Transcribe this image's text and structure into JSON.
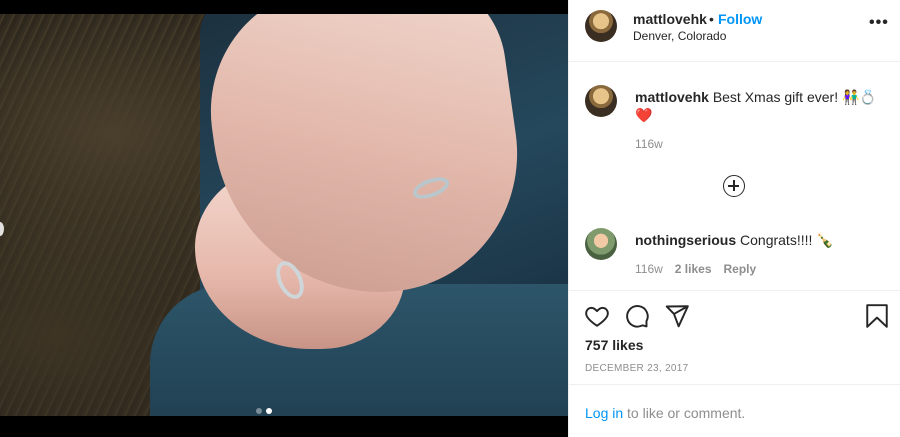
{
  "photo": {
    "carousel_total": 2,
    "carousel_active_index": 2
  },
  "header": {
    "username": "mattlovehk",
    "separator": "•",
    "follow_label": "Follow",
    "location": "Denver, Colorado",
    "more_icon": "more-options-icon",
    "more_label": "•••"
  },
  "caption": {
    "username": "mattlovehk",
    "text": "Best Xmas gift ever! 👫💍",
    "emoji_line": "❤️",
    "age": "116w"
  },
  "load_more_icon": "plus-circle-icon",
  "comments": [
    {
      "username": "nothingserious",
      "text": "Congrats!!!! 🍾",
      "age": "116w",
      "likes_label": "2 likes",
      "reply_label": "Reply"
    }
  ],
  "actions": {
    "like_icon": "heart-icon",
    "comment_icon": "comment-icon",
    "share_icon": "paper-plane-icon",
    "save_icon": "bookmark-icon",
    "likes_text": "757 likes",
    "date_text": "DECEMBER 23, 2017"
  },
  "footer": {
    "login_label": "Log in",
    "rest_text": "to like or comment."
  },
  "colors": {
    "accent": "#0095f6",
    "text": "#262626",
    "muted": "#8e8e8e",
    "border": "#efefef"
  }
}
